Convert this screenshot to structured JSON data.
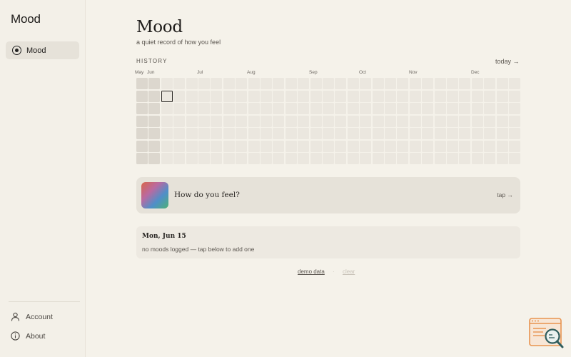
{
  "sidebar": {
    "app_title": "Mood",
    "nav_items": [
      {
        "label": "Mood",
        "icon": "radio-icon",
        "active": true
      }
    ],
    "bottom_links": [
      {
        "label": "Account",
        "icon": "person-icon"
      },
      {
        "label": "About",
        "icon": "info-icon"
      }
    ]
  },
  "main": {
    "title": "Mood",
    "subtitle": "a quiet record of how you feel",
    "history_label": "HISTORY",
    "today_link": "today →",
    "months": [
      "May",
      "Jun",
      "Jul",
      "Aug",
      "Sep",
      "Oct",
      "Nov",
      "Dec"
    ],
    "feel_prompt": "How do you feel?",
    "tap_link": "tap →",
    "selected_day": {
      "title": "Mon, Jun 15",
      "message": "no moods logged — tap below to add one"
    },
    "demo_link": "demo data",
    "separator": "·",
    "clear_link": "clear"
  },
  "colors": {
    "background": "#f5f2ea",
    "cell": "#ebe7df",
    "cell_past": "#dcd7ce",
    "card": "#e6e2d9"
  }
}
